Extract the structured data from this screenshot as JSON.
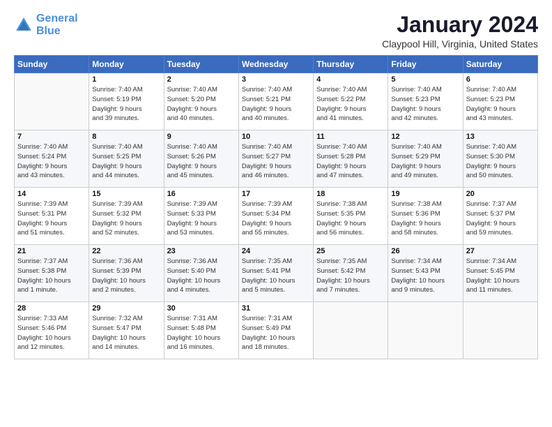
{
  "logo": {
    "line1": "General",
    "line2": "Blue"
  },
  "title": "January 2024",
  "subtitle": "Claypool Hill, Virginia, United States",
  "weekdays": [
    "Sunday",
    "Monday",
    "Tuesday",
    "Wednesday",
    "Thursday",
    "Friday",
    "Saturday"
  ],
  "weeks": [
    [
      {
        "day": "",
        "info": ""
      },
      {
        "day": "1",
        "info": "Sunrise: 7:40 AM\nSunset: 5:19 PM\nDaylight: 9 hours\nand 39 minutes."
      },
      {
        "day": "2",
        "info": "Sunrise: 7:40 AM\nSunset: 5:20 PM\nDaylight: 9 hours\nand 40 minutes."
      },
      {
        "day": "3",
        "info": "Sunrise: 7:40 AM\nSunset: 5:21 PM\nDaylight: 9 hours\nand 40 minutes."
      },
      {
        "day": "4",
        "info": "Sunrise: 7:40 AM\nSunset: 5:22 PM\nDaylight: 9 hours\nand 41 minutes."
      },
      {
        "day": "5",
        "info": "Sunrise: 7:40 AM\nSunset: 5:23 PM\nDaylight: 9 hours\nand 42 minutes."
      },
      {
        "day": "6",
        "info": "Sunrise: 7:40 AM\nSunset: 5:23 PM\nDaylight: 9 hours\nand 43 minutes."
      }
    ],
    [
      {
        "day": "7",
        "info": "Sunrise: 7:40 AM\nSunset: 5:24 PM\nDaylight: 9 hours\nand 43 minutes."
      },
      {
        "day": "8",
        "info": "Sunrise: 7:40 AM\nSunset: 5:25 PM\nDaylight: 9 hours\nand 44 minutes."
      },
      {
        "day": "9",
        "info": "Sunrise: 7:40 AM\nSunset: 5:26 PM\nDaylight: 9 hours\nand 45 minutes."
      },
      {
        "day": "10",
        "info": "Sunrise: 7:40 AM\nSunset: 5:27 PM\nDaylight: 9 hours\nand 46 minutes."
      },
      {
        "day": "11",
        "info": "Sunrise: 7:40 AM\nSunset: 5:28 PM\nDaylight: 9 hours\nand 47 minutes."
      },
      {
        "day": "12",
        "info": "Sunrise: 7:40 AM\nSunset: 5:29 PM\nDaylight: 9 hours\nand 49 minutes."
      },
      {
        "day": "13",
        "info": "Sunrise: 7:40 AM\nSunset: 5:30 PM\nDaylight: 9 hours\nand 50 minutes."
      }
    ],
    [
      {
        "day": "14",
        "info": "Sunrise: 7:39 AM\nSunset: 5:31 PM\nDaylight: 9 hours\nand 51 minutes."
      },
      {
        "day": "15",
        "info": "Sunrise: 7:39 AM\nSunset: 5:32 PM\nDaylight: 9 hours\nand 52 minutes."
      },
      {
        "day": "16",
        "info": "Sunrise: 7:39 AM\nSunset: 5:33 PM\nDaylight: 9 hours\nand 53 minutes."
      },
      {
        "day": "17",
        "info": "Sunrise: 7:39 AM\nSunset: 5:34 PM\nDaylight: 9 hours\nand 55 minutes."
      },
      {
        "day": "18",
        "info": "Sunrise: 7:38 AM\nSunset: 5:35 PM\nDaylight: 9 hours\nand 56 minutes."
      },
      {
        "day": "19",
        "info": "Sunrise: 7:38 AM\nSunset: 5:36 PM\nDaylight: 9 hours\nand 58 minutes."
      },
      {
        "day": "20",
        "info": "Sunrise: 7:37 AM\nSunset: 5:37 PM\nDaylight: 9 hours\nand 59 minutes."
      }
    ],
    [
      {
        "day": "21",
        "info": "Sunrise: 7:37 AM\nSunset: 5:38 PM\nDaylight: 10 hours\nand 1 minute."
      },
      {
        "day": "22",
        "info": "Sunrise: 7:36 AM\nSunset: 5:39 PM\nDaylight: 10 hours\nand 2 minutes."
      },
      {
        "day": "23",
        "info": "Sunrise: 7:36 AM\nSunset: 5:40 PM\nDaylight: 10 hours\nand 4 minutes."
      },
      {
        "day": "24",
        "info": "Sunrise: 7:35 AM\nSunset: 5:41 PM\nDaylight: 10 hours\nand 5 minutes."
      },
      {
        "day": "25",
        "info": "Sunrise: 7:35 AM\nSunset: 5:42 PM\nDaylight: 10 hours\nand 7 minutes."
      },
      {
        "day": "26",
        "info": "Sunrise: 7:34 AM\nSunset: 5:43 PM\nDaylight: 10 hours\nand 9 minutes."
      },
      {
        "day": "27",
        "info": "Sunrise: 7:34 AM\nSunset: 5:45 PM\nDaylight: 10 hours\nand 11 minutes."
      }
    ],
    [
      {
        "day": "28",
        "info": "Sunrise: 7:33 AM\nSunset: 5:46 PM\nDaylight: 10 hours\nand 12 minutes."
      },
      {
        "day": "29",
        "info": "Sunrise: 7:32 AM\nSunset: 5:47 PM\nDaylight: 10 hours\nand 14 minutes."
      },
      {
        "day": "30",
        "info": "Sunrise: 7:31 AM\nSunset: 5:48 PM\nDaylight: 10 hours\nand 16 minutes."
      },
      {
        "day": "31",
        "info": "Sunrise: 7:31 AM\nSunset: 5:49 PM\nDaylight: 10 hours\nand 18 minutes."
      },
      {
        "day": "",
        "info": ""
      },
      {
        "day": "",
        "info": ""
      },
      {
        "day": "",
        "info": ""
      }
    ]
  ]
}
